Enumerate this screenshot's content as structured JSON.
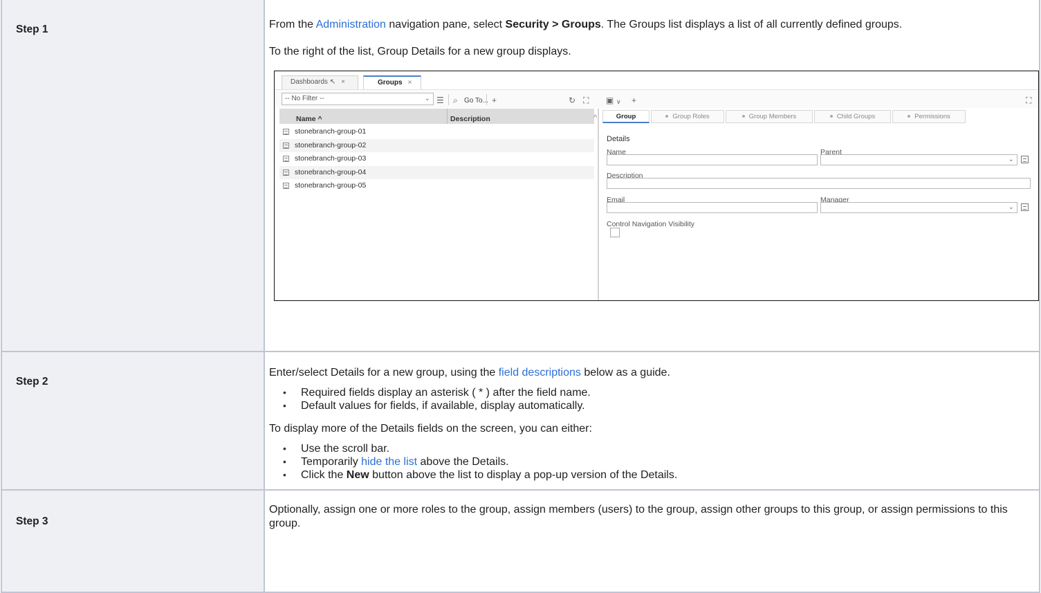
{
  "steps": [
    {
      "label": "Step 1",
      "p1_pre": "From the ",
      "p1_link": "Administration",
      "p1_mid": " navigation pane, select ",
      "p1_bold": "Security > Groups",
      "p1_post": ". The Groups list displays a list of all currently defined groups.",
      "p2": "To the right of the list, Group Details for a new group displays."
    },
    {
      "label": "Step 2",
      "p1_pre": "Enter/select Details for a new group, using the ",
      "p1_link": "field descriptions",
      "p1_post": " below as a guide.",
      "bullets1": [
        "Required fields display an asterisk ( * ) after the field name.",
        "Default values for fields, if available, display automatically."
      ],
      "p2": "To display more of the Details fields on the screen, you can either:",
      "b2_1": "Use the scroll bar.",
      "b2_2_pre": "Temporarily ",
      "b2_2_link": "hide the list",
      "b2_2_post": " above the Details.",
      "b2_3_pre": "Click the ",
      "b2_3_bold": "New",
      "b2_3_post": " button above the list to display a pop-up version of the Details."
    },
    {
      "label": "Step 3",
      "p1": "Optionally, assign one or more roles to the group, assign members (users) to the group, assign other groups to this group, or assign permissions to this group."
    }
  ],
  "app": {
    "tabs": [
      {
        "label": "Dashboards",
        "pin": "↖",
        "close": "×"
      },
      {
        "label": "Groups",
        "close": "×"
      }
    ],
    "toolbar": {
      "filter_value": "-- No Filter --",
      "goto_label": "Go To...",
      "add_icon": "+",
      "refresh_icon": "↻",
      "expand_icon": "⛶",
      "save_icon": "▣",
      "save_chev": "∨",
      "add2_icon": "+",
      "fullscreen_icon": "⛶"
    },
    "list": {
      "headers": {
        "name": "Name",
        "description": "Description"
      },
      "rows": [
        "stonebranch-group-01",
        "stonebranch-group-02",
        "stonebranch-group-03",
        "stonebranch-group-04",
        "stonebranch-group-05"
      ]
    },
    "details": {
      "tabs": [
        "Group",
        "Group Roles",
        "Group Members",
        "Child Groups",
        "Permissions"
      ],
      "section_title": "Details",
      "labels": {
        "name": "Name",
        "parent": "Parent",
        "description": "Description",
        "email": "Email",
        "manager": "Manager",
        "control_nav": "Control Navigation Visibility"
      }
    }
  }
}
